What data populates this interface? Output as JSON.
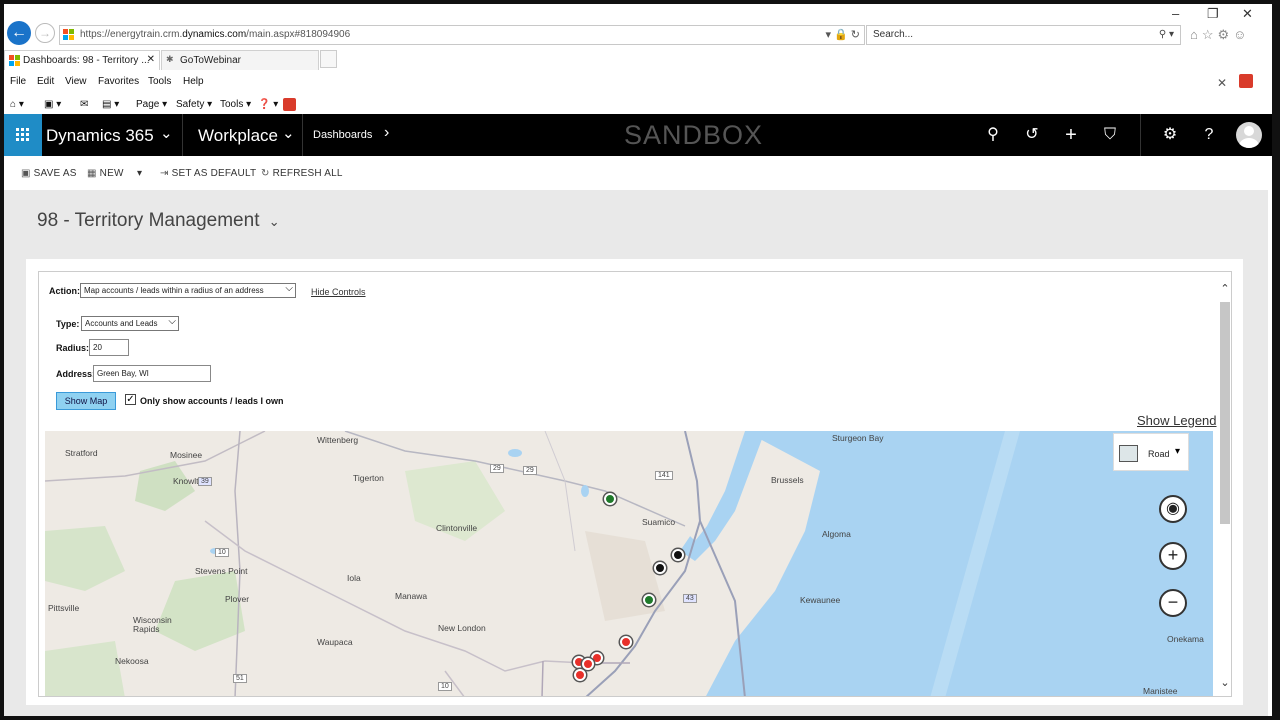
{
  "browser": {
    "url_prefix": "https://energytrain.crm.",
    "url_domain": "dynamics.com",
    "url_suffix": "/main.aspx#818094906",
    "url_tools": "▾ 🔒 ↻",
    "search_placeholder": "Search...",
    "search_icon": "⚲ ▾",
    "right_icons": "⌂☆⚙☺",
    "window_controls": [
      "–",
      "❐",
      "✕"
    ],
    "tabs": [
      {
        "label": "Dashboards: 98 - Territory ...",
        "close": "✕"
      },
      {
        "label": "GoToWebinar",
        "close": ""
      }
    ],
    "menu": [
      "File",
      "Edit",
      "View",
      "Favorites",
      "Tools",
      "Help"
    ],
    "menu_close": "✕",
    "commands": [
      "Page ▾",
      "Safety ▾",
      "Tools ▾"
    ],
    "command_icons": [
      "⌂ ▾",
      "▣ ▾",
      "✉",
      "▤ ▾",
      "❓ ▾"
    ]
  },
  "nav": {
    "app": "Dynamics 365",
    "area": "Workplace",
    "crumb": "Dashboards",
    "caret": "⌄",
    "arrow": "›",
    "watermark": "SANDBOX",
    "icons": [
      "search-icon",
      "history-icon",
      "plus-icon",
      "filter-icon",
      "gear-icon",
      "help-icon"
    ],
    "icon_glyphs": [
      "⚲",
      "↺",
      "+",
      "⛉",
      "⚙",
      "?"
    ]
  },
  "actions": [
    {
      "icon": "▣",
      "label": "SAVE AS"
    },
    {
      "icon": "▦",
      "label": "NEW"
    },
    {
      "icon": "▾",
      "label": ""
    },
    {
      "icon": "⇥",
      "label": "SET AS DEFAULT"
    },
    {
      "icon": "↻",
      "label": "REFRESH ALL"
    }
  ],
  "dashboard": {
    "title": "98 - Territory Management",
    "title_caret": "⌄"
  },
  "controls": {
    "action_label": "Action:",
    "action_value": "Map accounts / leads within a radius of an address",
    "hide_controls": "Hide Controls",
    "type_label": "Type:",
    "type_value": "Accounts and Leads",
    "radius_label": "Radius:",
    "radius_value": "20",
    "address_label": "Address:",
    "address_value": "Green Bay, WI",
    "show_map": "Show Map",
    "only_mine_checked": "✓",
    "only_mine": "Only show accounts / leads I own",
    "show_legend": "Show Legend",
    "dropdown_glyph": "⌵"
  },
  "map": {
    "road_label": "Road",
    "road_caret": "▾",
    "locate_glyph": "◉",
    "zoom_in": "+",
    "zoom_out": "−",
    "scroll_up": "⌃",
    "scroll_down": "⌄",
    "places": [
      "Stratford",
      "Mosinee",
      "Knowlton",
      "Wittenberg",
      "Tigerton",
      "Sturgeon Bay",
      "Brussels",
      "Suamico",
      "Clintonville",
      "Algoma",
      "Stevens Point",
      "Iola",
      "Plover",
      "Manawa",
      "Kewaunee",
      "Pittsville",
      "Wisconsin Rapids",
      "New London",
      "Waupaca",
      "Nekoosa",
      "Onekama",
      "Manistee"
    ],
    "route_shields": [
      "29",
      "29",
      "141",
      "39",
      "10",
      "43",
      "51",
      "10"
    ],
    "pin_colors": {
      "green": "#1f7a2a",
      "black": "#111111",
      "red": "#e8302a"
    }
  }
}
